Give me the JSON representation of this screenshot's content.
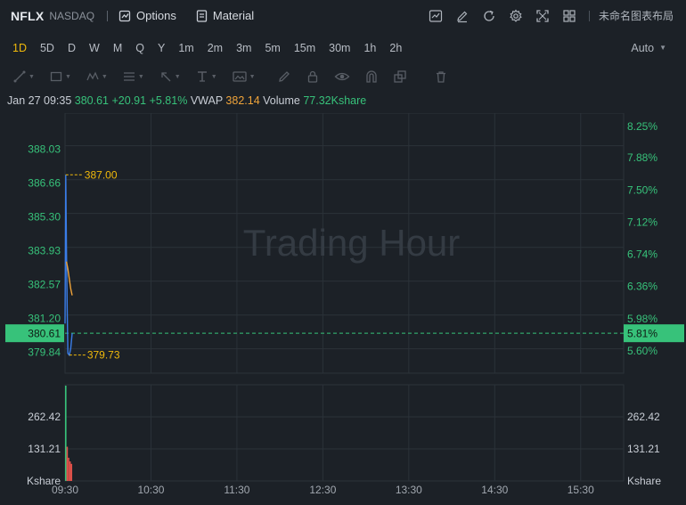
{
  "header": {
    "symbol": "NFLX",
    "exchange": "NASDAQ",
    "options_label": "Options",
    "material_label": "Material",
    "layout_name": "未命名图表布局",
    "icons": [
      "chart-line-icon",
      "edit-icon",
      "refresh-icon",
      "gear-icon",
      "fullscreen-icon",
      "grid-layout-icon"
    ]
  },
  "periods": {
    "items": [
      "1D",
      "5D",
      "D",
      "W",
      "M",
      "Q",
      "Y",
      "1m",
      "2m",
      "3m",
      "5m",
      "15m",
      "30m",
      "1h",
      "2h"
    ],
    "active": "1D",
    "scale_mode": "Auto"
  },
  "drawing_tools": [
    "trend-line-icon",
    "rectangle-icon",
    "pattern-icon",
    "fib-icon",
    "arrow-icon",
    "text-icon",
    "image-icon",
    "pencil-icon",
    "lock-icon",
    "eye-icon",
    "magnet-icon",
    "clone-icon",
    "trash-icon"
  ],
  "info": {
    "date": "Jan 27 09:35",
    "price": "380.61",
    "change": "+20.91",
    "change_pct": "+5.81%",
    "vwap_label": "VWAP",
    "vwap": "382.14",
    "volume_label": "Volume",
    "volume": "77.32Kshare"
  },
  "chart_data": {
    "type": "line",
    "watermark": "Trading Hour",
    "x_ticks": [
      "09:30",
      "10:30",
      "11:30",
      "12:30",
      "13:30",
      "14:30",
      "15:30"
    ],
    "price_ticks": [
      "388.03",
      "386.66",
      "385.30",
      "383.93",
      "382.57",
      "381.20",
      "379.84"
    ],
    "price_tick_values": [
      388.03,
      386.66,
      385.3,
      383.93,
      382.57,
      381.2,
      379.84
    ],
    "pct_ticks": [
      "8.25%",
      "7.88%",
      "7.50%",
      "7.12%",
      "6.74%",
      "6.36%",
      "5.98%",
      "5.60%"
    ],
    "pct_tick_values": [
      8.25,
      7.88,
      7.5,
      7.12,
      6.74,
      6.36,
      5.98,
      5.6
    ],
    "ylim": [
      379.0,
      389.2
    ],
    "current_price": "380.61",
    "current_price_value": 380.61,
    "current_pct": "5.81%",
    "high_label": "387.00",
    "high_value": 387.0,
    "low_label": "379.73",
    "low_value": 379.73,
    "series": [
      {
        "name": "Price",
        "color": "#3a7de8",
        "x_minutes": [
          0,
          0.5,
          1,
          1.5,
          2,
          3,
          4,
          5
        ],
        "values": [
          381.0,
          387.0,
          384.0,
          381.6,
          379.8,
          379.73,
          380.0,
          380.61
        ]
      },
      {
        "name": "VWAP",
        "color": "#f0a43a",
        "x_minutes": [
          1,
          2,
          3,
          4,
          5
        ],
        "values": [
          383.5,
          383.2,
          382.8,
          382.4,
          382.14
        ]
      }
    ],
    "volume_ticks": [
      "262.42",
      "131.21"
    ],
    "volume_tick_values": [
      262.42,
      131.21
    ],
    "volume_unit": "Kshare",
    "volume_max": 393.6,
    "volume_bars": [
      {
        "minute": 0,
        "value": 390.0,
        "color": "#37c27a"
      },
      {
        "minute": 1,
        "value": 140.0,
        "color": "#e0514a"
      },
      {
        "minute": 2,
        "value": 95.0,
        "color": "#e0514a"
      },
      {
        "minute": 3,
        "value": 80.0,
        "color": "#e0514a"
      },
      {
        "minute": 4,
        "value": 70.0,
        "color": "#e0514a"
      }
    ],
    "colors": {
      "up": "#37c27a",
      "down": "#e0514a",
      "high_low_label": "#f0b90b",
      "current_badge": "#37c27a",
      "grid": "#2b3239"
    }
  }
}
